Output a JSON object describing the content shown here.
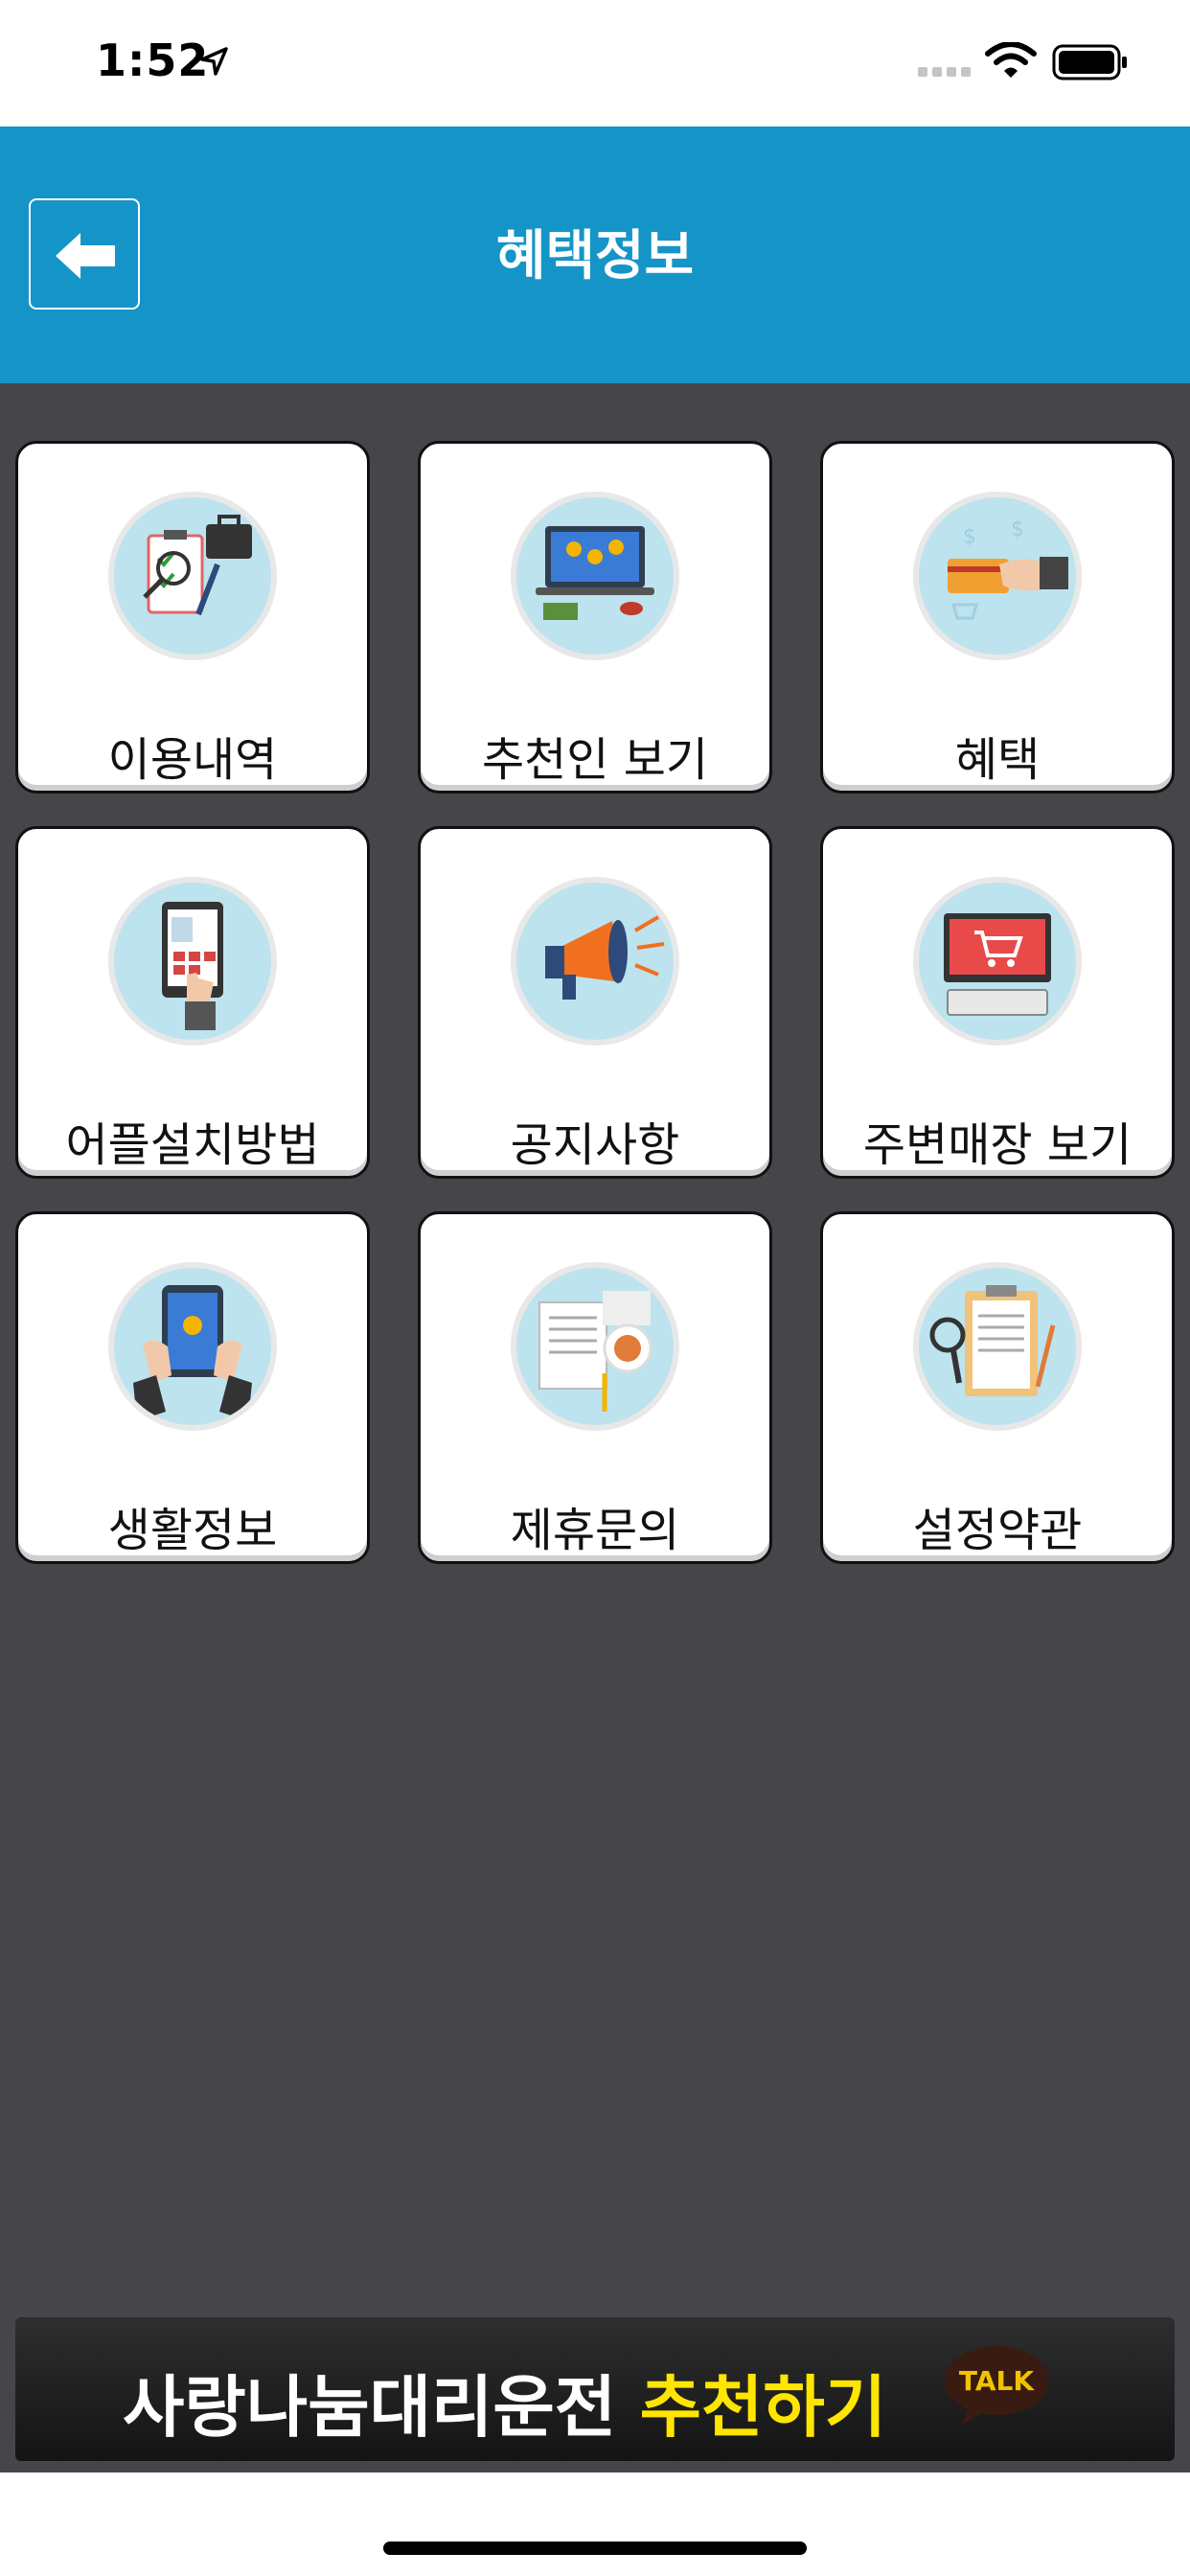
{
  "status_bar": {
    "time": "1:52"
  },
  "header": {
    "title": "혜택정보"
  },
  "tiles": [
    {
      "label": "이용내역",
      "icon": "clipboard-briefcase-icon"
    },
    {
      "label": "추천인 보기",
      "icon": "laptop-coins-icon"
    },
    {
      "label": "혜택",
      "icon": "card-payment-icon"
    },
    {
      "label": "어플설치방법",
      "icon": "tablet-hand-icon"
    },
    {
      "label": "공지사항",
      "icon": "megaphone-icon"
    },
    {
      "label": "주변매장 보기",
      "icon": "shop-monitor-icon"
    },
    {
      "label": "생활정보",
      "icon": "phone-hands-icon"
    },
    {
      "label": "제휴문의",
      "icon": "documents-coffee-icon"
    },
    {
      "label": "설정약관",
      "icon": "clipboard-magnifier-icon"
    }
  ],
  "banner": {
    "text": "사랑나눔대리운전",
    "highlight": "추천하기",
    "talk_label": "TALK"
  },
  "colors": {
    "header": "#1595c7",
    "background": "#46464a",
    "highlight": "#ffe600"
  }
}
